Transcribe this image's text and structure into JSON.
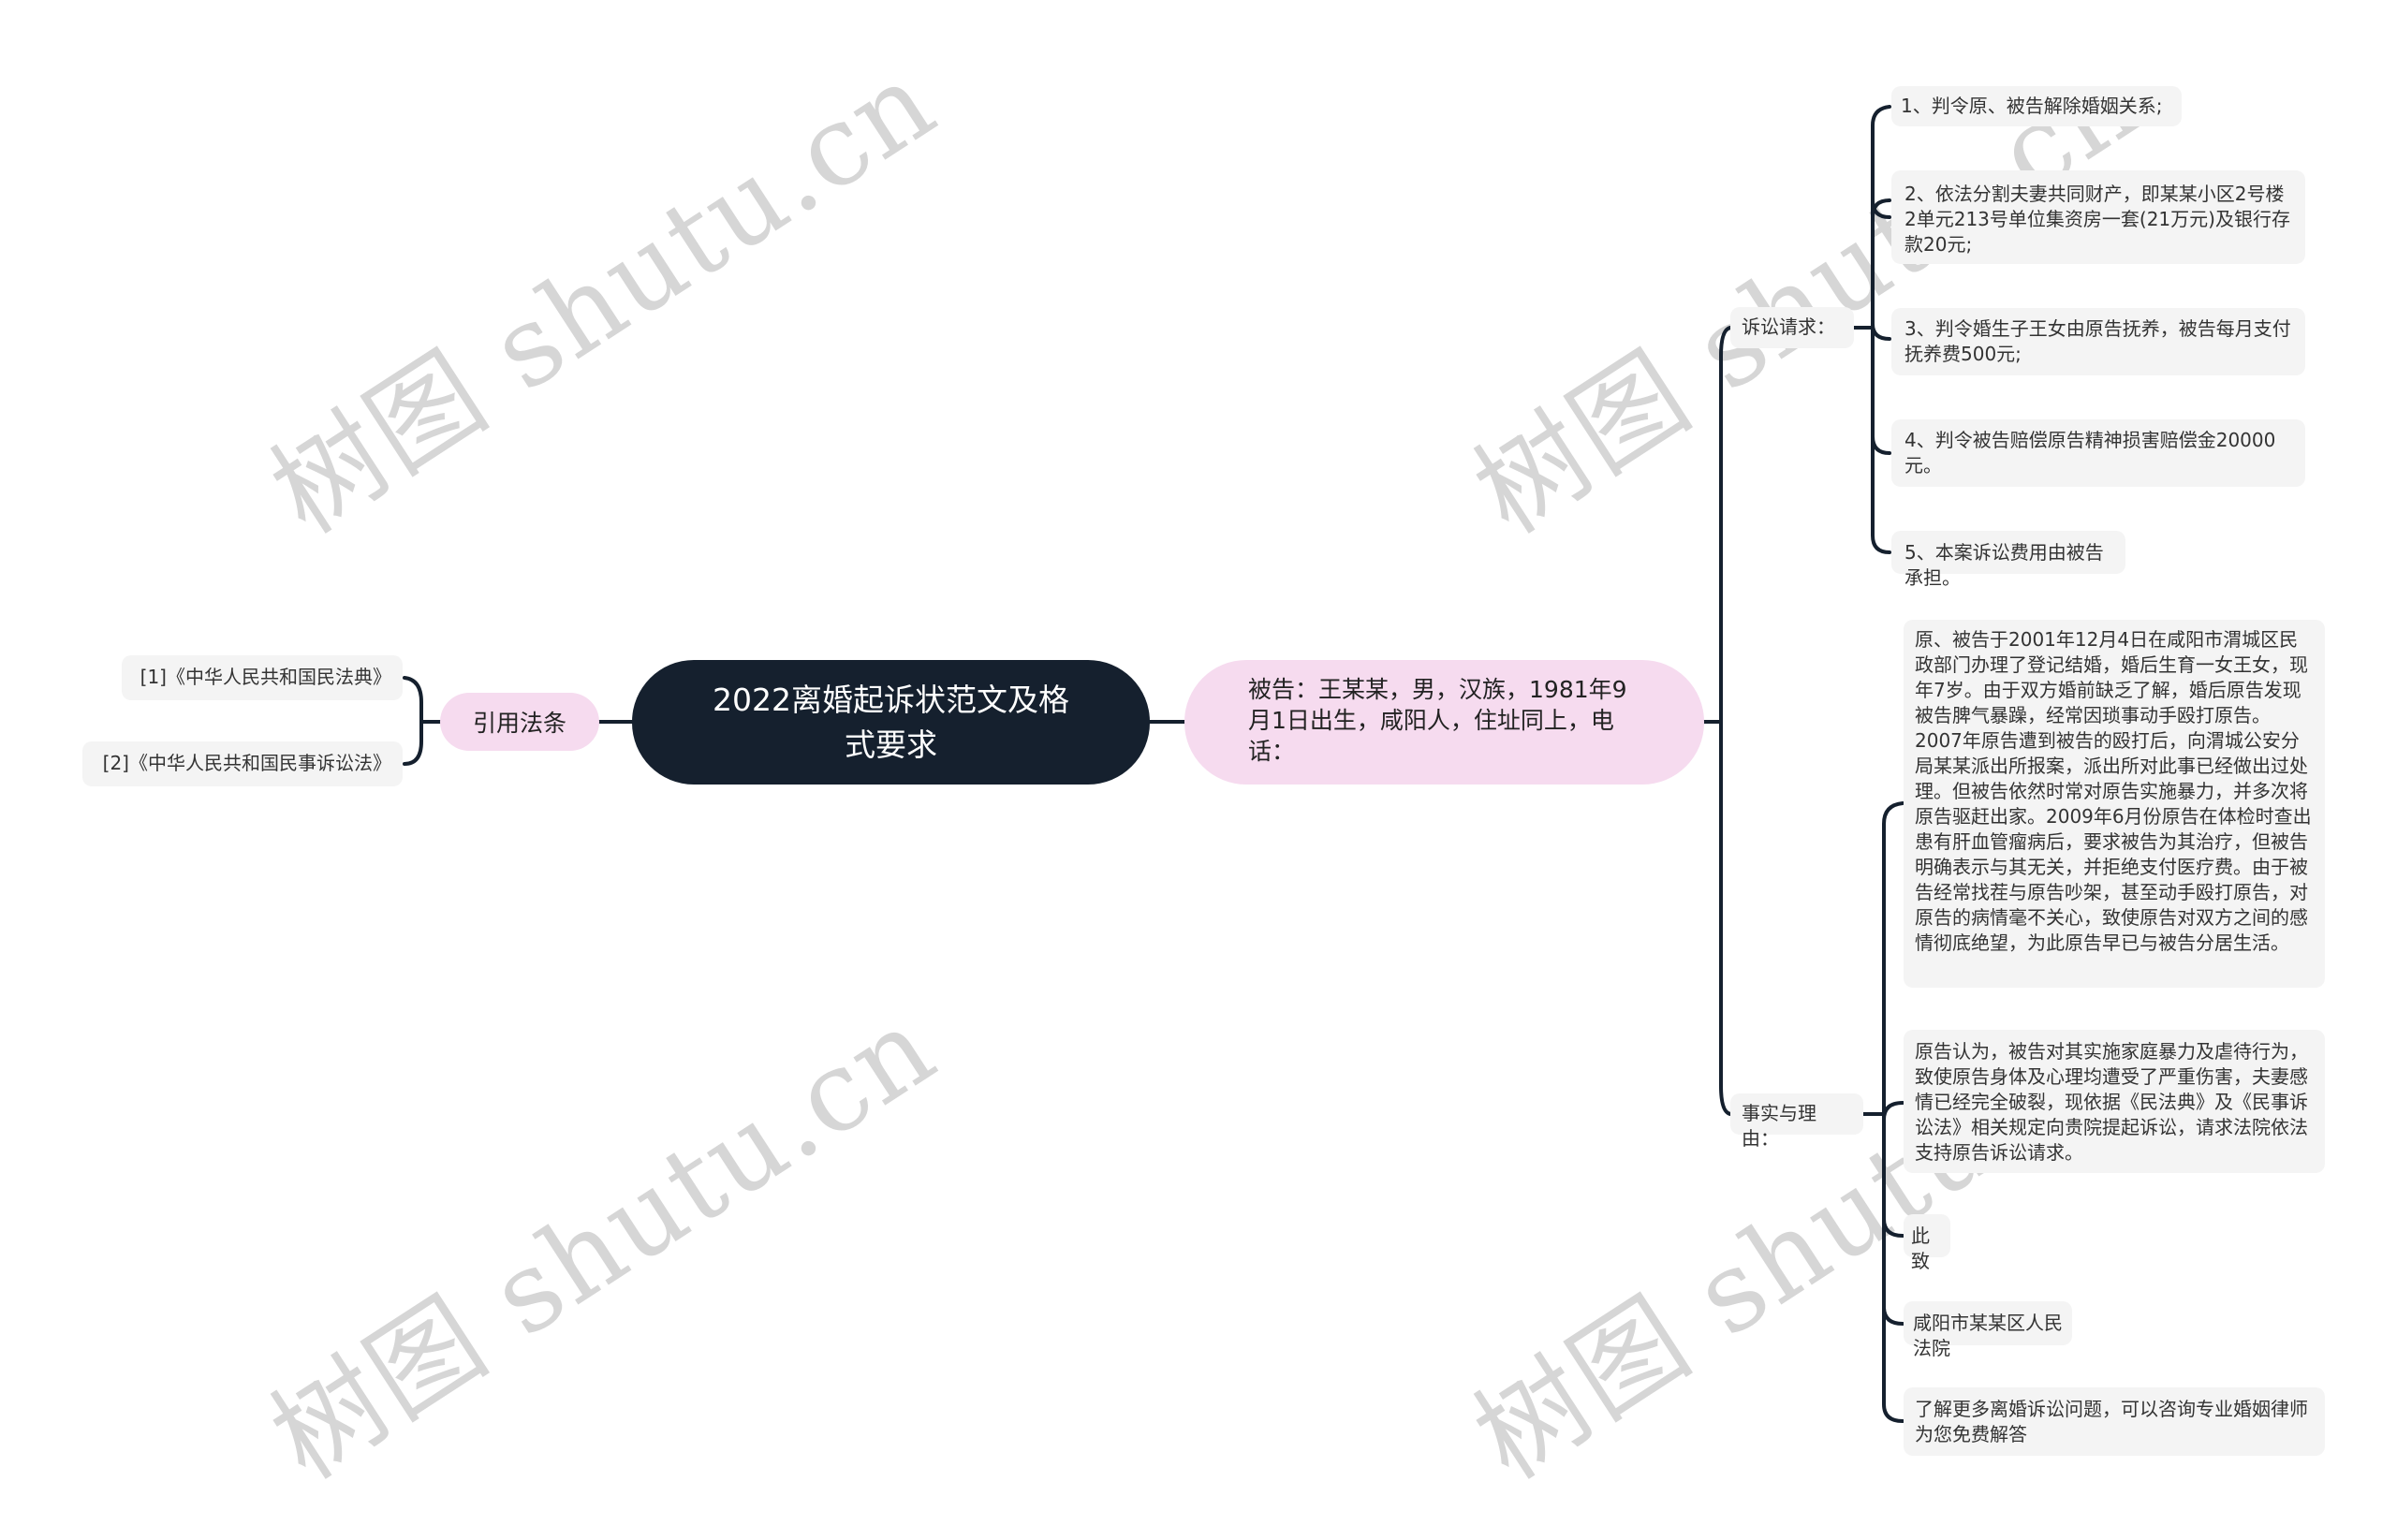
{
  "watermark": "树图 shutu.cn",
  "root": {
    "title": "2022离婚起诉状范文及格式要求"
  },
  "citations": {
    "label": "引用法条",
    "items": [
      "[1]《中华人民共和国民法典》",
      "[2]《中华人民共和国民事诉讼法》"
    ]
  },
  "defendant": {
    "text": "被告：王某某，男，汉族，1981年9月1日出生，咸阳人，住址同上，电话："
  },
  "claims": {
    "label": "诉讼请求：",
    "items": [
      "1、判令原、被告解除婚姻关系;",
      "2、依法分割夫妻共同财产，即某某小区2号楼2单元213号单位集资房一套(21万元)及银行存款20元;",
      "3、判令婚生子王女由原告抚养，被告每月支付抚养费500元;",
      "4、判令被告赔偿原告精神损害赔偿金20000元。",
      "5、本案诉讼费用由被告承担。"
    ]
  },
  "facts": {
    "label": "事实与理由：",
    "items": [
      "原、被告于2001年12月4日在咸阳市渭城区民政部门办理了登记结婚，婚后生育一女王女，现年7岁。由于双方婚前缺乏了解，婚后原告发现被告脾气暴躁，经常因琐事动手殴打原告。2007年原告遭到被告的殴打后，向渭城公安分局某某派出所报案，派出所对此事已经做出过处理。但被告依然时常对原告实施暴力，并多次将原告驱赶出家。2009年6月份原告在体检时查出患有肝血管瘤病后，要求被告为其治疗，但被告明确表示与其无关，并拒绝支付医疗费。由于被告经常找茬与原告吵架，甚至动手殴打原告，对原告的病情毫不关心，致使原告对双方之间的感情彻底绝望，为此原告早已与被告分居生活。",
      "原告认为，被告对其实施家庭暴力及虐待行为，致使原告身体及心理均遭受了严重伤害，夫妻感情已经完全破裂，现依据《民法典》及《民事诉讼法》相关规定向贵院提起诉讼，请求法院依法支持原告诉讼请求。",
      "此致",
      "咸阳市某某区人民法院",
      "了解更多离婚诉讼问题，可以咨询专业婚姻律师为您免费解答"
    ]
  },
  "colors": {
    "root_bg": "#15202e",
    "pink_node": "#f6dbef",
    "leaf_bg": "#f4f4f4",
    "connector": "#15202e",
    "watermark": "#d6d6d6"
  }
}
